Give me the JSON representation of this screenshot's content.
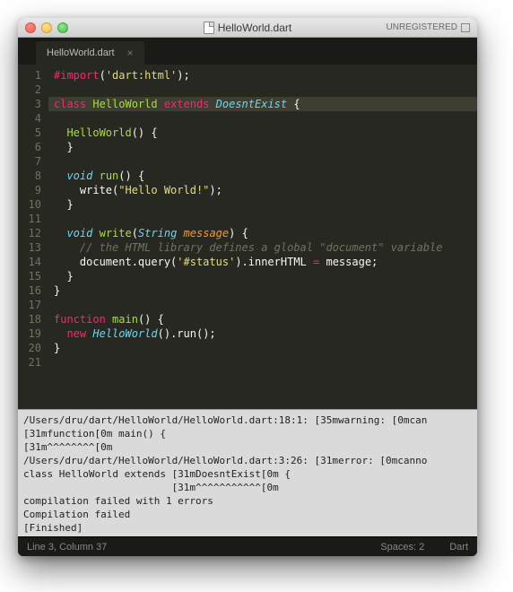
{
  "window": {
    "title": "HelloWorld.dart",
    "unregistered_label": "UNREGISTERED"
  },
  "tab": {
    "label": "HelloWorld.dart",
    "close_glyph": "×"
  },
  "code": {
    "lines": [
      {
        "n": 1,
        "tokens": [
          [
            "kw",
            "#import"
          ],
          [
            "plain",
            "("
          ],
          [
            "str",
            "'dart:html'"
          ],
          [
            "plain",
            ");"
          ]
        ]
      },
      {
        "n": 2,
        "tokens": []
      },
      {
        "n": 3,
        "hl": true,
        "tokens": [
          [
            "kw",
            "class"
          ],
          [
            "plain",
            " "
          ],
          [
            "fn",
            "HelloWorld"
          ],
          [
            "plain",
            " "
          ],
          [
            "kw",
            "extends"
          ],
          [
            "plain",
            " "
          ],
          [
            "type",
            "DoesntExist"
          ],
          [
            "plain",
            " {"
          ]
        ]
      },
      {
        "n": 4,
        "tokens": []
      },
      {
        "n": 5,
        "tokens": [
          [
            "plain",
            "  "
          ],
          [
            "fn",
            "HelloWorld"
          ],
          [
            "plain",
            "() {"
          ]
        ]
      },
      {
        "n": 6,
        "tokens": [
          [
            "plain",
            "  }"
          ]
        ]
      },
      {
        "n": 7,
        "tokens": []
      },
      {
        "n": 8,
        "tokens": [
          [
            "plain",
            "  "
          ],
          [
            "type",
            "void"
          ],
          [
            "plain",
            " "
          ],
          [
            "fn",
            "run"
          ],
          [
            "plain",
            "() {"
          ]
        ]
      },
      {
        "n": 9,
        "tokens": [
          [
            "plain",
            "    write("
          ],
          [
            "str",
            "\"Hello World!\""
          ],
          [
            "plain",
            ");"
          ]
        ]
      },
      {
        "n": 10,
        "tokens": [
          [
            "plain",
            "  }"
          ]
        ]
      },
      {
        "n": 11,
        "tokens": []
      },
      {
        "n": 12,
        "tokens": [
          [
            "plain",
            "  "
          ],
          [
            "type",
            "void"
          ],
          [
            "plain",
            " "
          ],
          [
            "fn",
            "write"
          ],
          [
            "plain",
            "("
          ],
          [
            "type",
            "String"
          ],
          [
            "plain",
            " "
          ],
          [
            "param",
            "message"
          ],
          [
            "plain",
            ") {"
          ]
        ]
      },
      {
        "n": 13,
        "tokens": [
          [
            "plain",
            "    "
          ],
          [
            "com",
            "// the HTML library defines a global \"document\" variable"
          ]
        ]
      },
      {
        "n": 14,
        "tokens": [
          [
            "plain",
            "    document.query("
          ],
          [
            "str",
            "'#status'"
          ],
          [
            "plain",
            ").innerHTML "
          ],
          [
            "op",
            "="
          ],
          [
            "plain",
            " message;"
          ]
        ]
      },
      {
        "n": 15,
        "tokens": [
          [
            "plain",
            "  }"
          ]
        ]
      },
      {
        "n": 16,
        "tokens": [
          [
            "plain",
            "}"
          ]
        ]
      },
      {
        "n": 17,
        "tokens": []
      },
      {
        "n": 18,
        "tokens": [
          [
            "kw",
            "function"
          ],
          [
            "plain",
            " "
          ],
          [
            "fn",
            "main"
          ],
          [
            "plain",
            "() {"
          ]
        ]
      },
      {
        "n": 19,
        "tokens": [
          [
            "plain",
            "  "
          ],
          [
            "kw",
            "new"
          ],
          [
            "plain",
            " "
          ],
          [
            "type",
            "HelloWorld"
          ],
          [
            "plain",
            "().run();"
          ]
        ]
      },
      {
        "n": 20,
        "tokens": [
          [
            "plain",
            "}"
          ]
        ]
      },
      {
        "n": 21,
        "tokens": []
      }
    ]
  },
  "console": {
    "lines": [
      "/Users/dru/dart/HelloWorld/HelloWorld.dart:18:1: [35mwarning: [0mcan",
      "[31mfunction[0m main() {",
      "[31m^^^^^^^^[0m",
      "/Users/dru/dart/HelloWorld/HelloWorld.dart:3:26: [31merror: [0mcanno",
      "class HelloWorld extends [31mDoesntExist[0m {",
      "                         [31m^^^^^^^^^^^[0m",
      "compilation failed with 1 errors",
      "Compilation failed",
      "[Finished]"
    ]
  },
  "status": {
    "position": "Line 3, Column 37",
    "spaces": "Spaces: 2",
    "syntax": "Dart"
  }
}
